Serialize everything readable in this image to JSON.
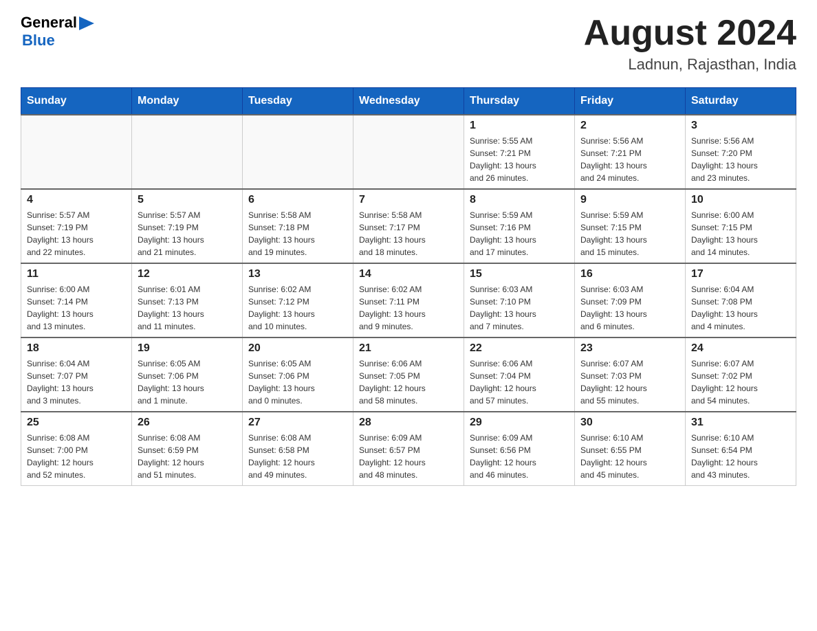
{
  "header": {
    "logo": {
      "general": "General",
      "arrow_unicode": "▶",
      "blue": "Blue"
    },
    "title": "August 2024",
    "location": "Ladnun, Rajasthan, India"
  },
  "days_of_week": [
    "Sunday",
    "Monday",
    "Tuesday",
    "Wednesday",
    "Thursday",
    "Friday",
    "Saturday"
  ],
  "weeks": [
    {
      "days": [
        {
          "number": "",
          "info": ""
        },
        {
          "number": "",
          "info": ""
        },
        {
          "number": "",
          "info": ""
        },
        {
          "number": "",
          "info": ""
        },
        {
          "number": "1",
          "info": "Sunrise: 5:55 AM\nSunset: 7:21 PM\nDaylight: 13 hours\nand 26 minutes."
        },
        {
          "number": "2",
          "info": "Sunrise: 5:56 AM\nSunset: 7:21 PM\nDaylight: 13 hours\nand 24 minutes."
        },
        {
          "number": "3",
          "info": "Sunrise: 5:56 AM\nSunset: 7:20 PM\nDaylight: 13 hours\nand 23 minutes."
        }
      ]
    },
    {
      "days": [
        {
          "number": "4",
          "info": "Sunrise: 5:57 AM\nSunset: 7:19 PM\nDaylight: 13 hours\nand 22 minutes."
        },
        {
          "number": "5",
          "info": "Sunrise: 5:57 AM\nSunset: 7:19 PM\nDaylight: 13 hours\nand 21 minutes."
        },
        {
          "number": "6",
          "info": "Sunrise: 5:58 AM\nSunset: 7:18 PM\nDaylight: 13 hours\nand 19 minutes."
        },
        {
          "number": "7",
          "info": "Sunrise: 5:58 AM\nSunset: 7:17 PM\nDaylight: 13 hours\nand 18 minutes."
        },
        {
          "number": "8",
          "info": "Sunrise: 5:59 AM\nSunset: 7:16 PM\nDaylight: 13 hours\nand 17 minutes."
        },
        {
          "number": "9",
          "info": "Sunrise: 5:59 AM\nSunset: 7:15 PM\nDaylight: 13 hours\nand 15 minutes."
        },
        {
          "number": "10",
          "info": "Sunrise: 6:00 AM\nSunset: 7:15 PM\nDaylight: 13 hours\nand 14 minutes."
        }
      ]
    },
    {
      "days": [
        {
          "number": "11",
          "info": "Sunrise: 6:00 AM\nSunset: 7:14 PM\nDaylight: 13 hours\nand 13 minutes."
        },
        {
          "number": "12",
          "info": "Sunrise: 6:01 AM\nSunset: 7:13 PM\nDaylight: 13 hours\nand 11 minutes."
        },
        {
          "number": "13",
          "info": "Sunrise: 6:02 AM\nSunset: 7:12 PM\nDaylight: 13 hours\nand 10 minutes."
        },
        {
          "number": "14",
          "info": "Sunrise: 6:02 AM\nSunset: 7:11 PM\nDaylight: 13 hours\nand 9 minutes."
        },
        {
          "number": "15",
          "info": "Sunrise: 6:03 AM\nSunset: 7:10 PM\nDaylight: 13 hours\nand 7 minutes."
        },
        {
          "number": "16",
          "info": "Sunrise: 6:03 AM\nSunset: 7:09 PM\nDaylight: 13 hours\nand 6 minutes."
        },
        {
          "number": "17",
          "info": "Sunrise: 6:04 AM\nSunset: 7:08 PM\nDaylight: 13 hours\nand 4 minutes."
        }
      ]
    },
    {
      "days": [
        {
          "number": "18",
          "info": "Sunrise: 6:04 AM\nSunset: 7:07 PM\nDaylight: 13 hours\nand 3 minutes."
        },
        {
          "number": "19",
          "info": "Sunrise: 6:05 AM\nSunset: 7:06 PM\nDaylight: 13 hours\nand 1 minute."
        },
        {
          "number": "20",
          "info": "Sunrise: 6:05 AM\nSunset: 7:06 PM\nDaylight: 13 hours\nand 0 minutes."
        },
        {
          "number": "21",
          "info": "Sunrise: 6:06 AM\nSunset: 7:05 PM\nDaylight: 12 hours\nand 58 minutes."
        },
        {
          "number": "22",
          "info": "Sunrise: 6:06 AM\nSunset: 7:04 PM\nDaylight: 12 hours\nand 57 minutes."
        },
        {
          "number": "23",
          "info": "Sunrise: 6:07 AM\nSunset: 7:03 PM\nDaylight: 12 hours\nand 55 minutes."
        },
        {
          "number": "24",
          "info": "Sunrise: 6:07 AM\nSunset: 7:02 PM\nDaylight: 12 hours\nand 54 minutes."
        }
      ]
    },
    {
      "days": [
        {
          "number": "25",
          "info": "Sunrise: 6:08 AM\nSunset: 7:00 PM\nDaylight: 12 hours\nand 52 minutes."
        },
        {
          "number": "26",
          "info": "Sunrise: 6:08 AM\nSunset: 6:59 PM\nDaylight: 12 hours\nand 51 minutes."
        },
        {
          "number": "27",
          "info": "Sunrise: 6:08 AM\nSunset: 6:58 PM\nDaylight: 12 hours\nand 49 minutes."
        },
        {
          "number": "28",
          "info": "Sunrise: 6:09 AM\nSunset: 6:57 PM\nDaylight: 12 hours\nand 48 minutes."
        },
        {
          "number": "29",
          "info": "Sunrise: 6:09 AM\nSunset: 6:56 PM\nDaylight: 12 hours\nand 46 minutes."
        },
        {
          "number": "30",
          "info": "Sunrise: 6:10 AM\nSunset: 6:55 PM\nDaylight: 12 hours\nand 45 minutes."
        },
        {
          "number": "31",
          "info": "Sunrise: 6:10 AM\nSunset: 6:54 PM\nDaylight: 12 hours\nand 43 minutes."
        }
      ]
    }
  ]
}
